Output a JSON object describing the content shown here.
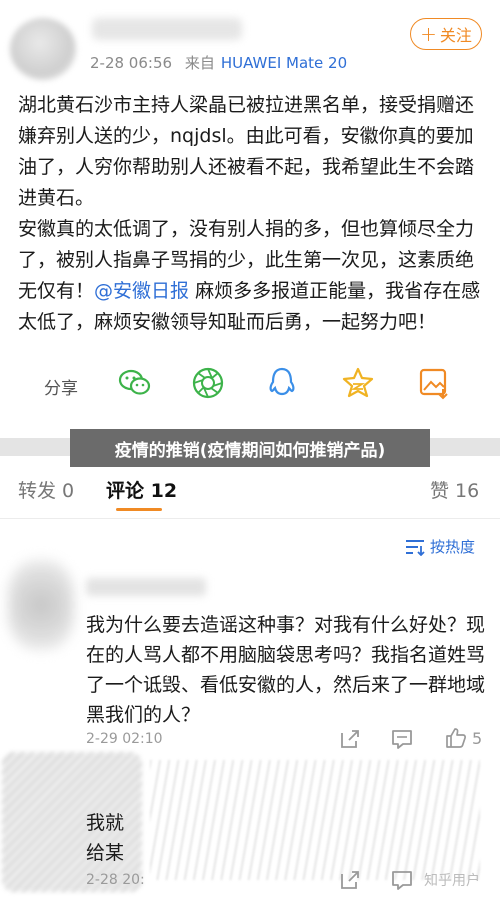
{
  "post": {
    "timestamp": "2-28 06:56",
    "source_prefix": "来自",
    "source_device": "HUAWEI Mate 20",
    "follow_label": "关注",
    "paragraph1": "湖北黄石沙市主持人梁晶已被拉进黑名单，接受捐赠还嫌弃别人送的少，nqjdsl。由此可看，安徽你真的要加油了，人穷你帮助别人还被看不起，我希望此生不会踏进黄石。",
    "paragraph2_before": "安徽真的太低调了，没有别人捐的多，但也算倾尽全力了，被别人指鼻子骂捐的少，此生第一次见，这素质绝无仅有！",
    "mention": "@安徽日报",
    "paragraph2_after": " 麻烦多多报道正能量，我省存在感太低了，麻烦安徽领导知耻而后勇，一起努力吧！"
  },
  "share": {
    "label": "分享",
    "icons": [
      "wechat-icon",
      "moments-icon",
      "qq-icon",
      "qzone-star-icon",
      "save-image-icon"
    ]
  },
  "banner": {
    "title": "疫情的推销(疫情期间如何推销产品)"
  },
  "tabs": {
    "repost": "转发 0",
    "comments": "评论 12",
    "likes": "赞 16"
  },
  "sort": {
    "label": "按热度"
  },
  "comments": [
    {
      "text": "我为什么要去造谣这种事？对我有什么好处？现在的人骂人都不用脑脑袋思考吗？我指名道姓骂了一个诋毁、看低安徽的人，然后来了一群地域黑我们的人？",
      "time": "2-29 02:10",
      "likes": "5"
    },
    {
      "text_line1": "我就",
      "text_line2": "给某",
      "time": "2-28 20:",
      "likes": ""
    }
  ],
  "watermark": "知乎用户",
  "colors": {
    "accent": "#f08a24",
    "link": "#2f6fd6",
    "banner": "#6b6b6b"
  }
}
